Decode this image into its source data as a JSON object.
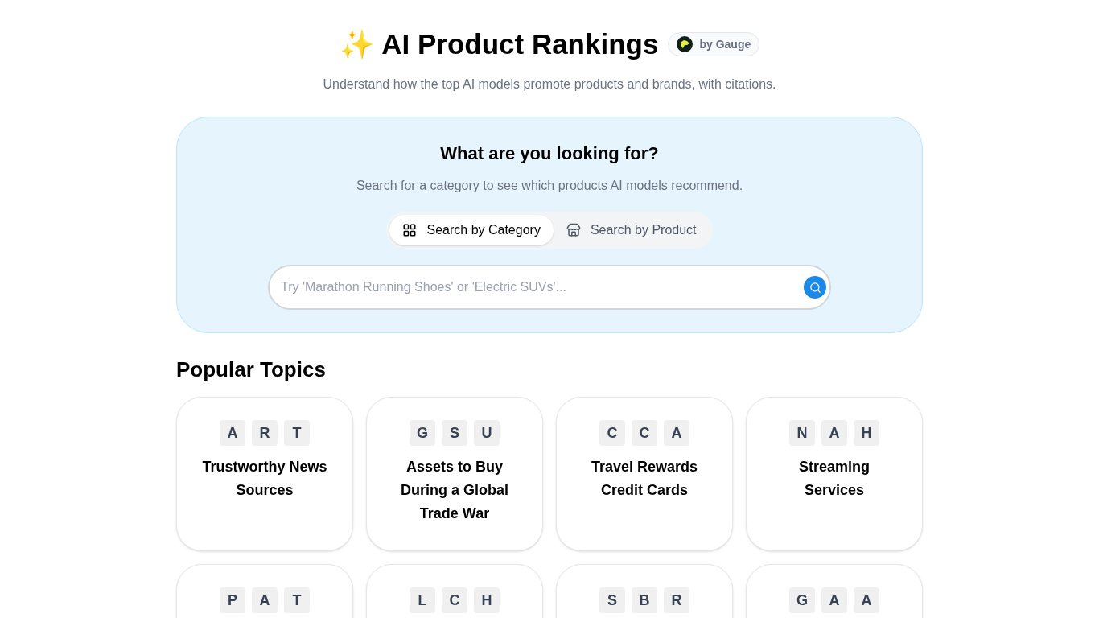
{
  "header": {
    "emoji": "✨",
    "title": "AI Product Rankings",
    "badge": "by Gauge",
    "subtitle": "Understand how the top AI models promote products and brands, with citations."
  },
  "search_panel": {
    "title": "What are you looking for?",
    "subtitle": "Search for a category to see which products AI models recommend.",
    "tabs": [
      {
        "label": "Search by Category",
        "kind": "grid",
        "selected": true
      },
      {
        "label": "Search by Product",
        "kind": "store",
        "selected": false
      }
    ],
    "placeholder": "Try 'Marathon Running Shoes' or 'Electric SUVs'..."
  },
  "popular_topics": {
    "title": "Popular Topics",
    "cards": [
      {
        "letters": [
          "A",
          "R",
          "T"
        ],
        "title": "Trustworthy News Sources"
      },
      {
        "letters": [
          "G",
          "S",
          "U"
        ],
        "title": "Assets to Buy During a Global Trade War"
      },
      {
        "letters": [
          "C",
          "C",
          "A"
        ],
        "title": "Travel Rewards Credit Cards"
      },
      {
        "letters": [
          "N",
          "A",
          "H"
        ],
        "title": "Streaming Services"
      },
      {
        "letters": [
          "P",
          "A",
          "T"
        ]
      },
      {
        "letters": [
          "L",
          "C",
          "H"
        ]
      },
      {
        "letters": [
          "S",
          "B",
          "R"
        ]
      },
      {
        "letters": [
          "G",
          "A",
          "A"
        ]
      }
    ]
  }
}
